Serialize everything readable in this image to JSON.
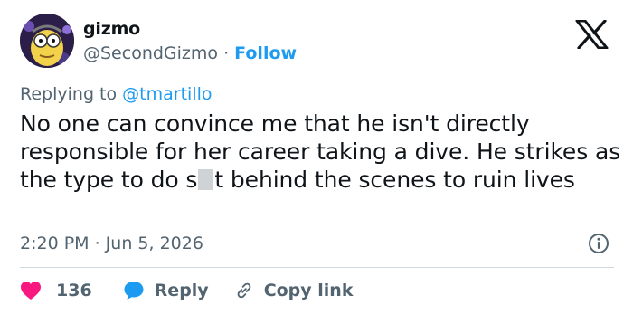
{
  "author": {
    "display_name": "gizmo",
    "handle": "@SecondGizmo",
    "separator": "·",
    "follow_label": "Follow"
  },
  "reply_context": {
    "prefix": "Replying to",
    "mention": "@tmartillo"
  },
  "tweet": {
    "text_before_censor": "No one can convince me that he isn't directly responsible for her career taking a dive. He strikes as the type to do s",
    "text_after_censor": "t behind the scenes to ruin lives"
  },
  "meta": {
    "timestamp": "2:20 PM · Jun 5, 2026"
  },
  "actions": {
    "like_count": "136",
    "reply_label": "Reply",
    "copy_link_label": "Copy link"
  },
  "icons": {
    "platform_logo": "x-logo-icon",
    "info": "info-icon",
    "like": "heart-icon",
    "reply": "speech-bubble-icon",
    "copy_link": "link-icon"
  },
  "colors": {
    "link_blue": "#1d9bf0",
    "secondary_text": "#536471",
    "like_red": "#f91880",
    "divider": "#cfd9de"
  }
}
